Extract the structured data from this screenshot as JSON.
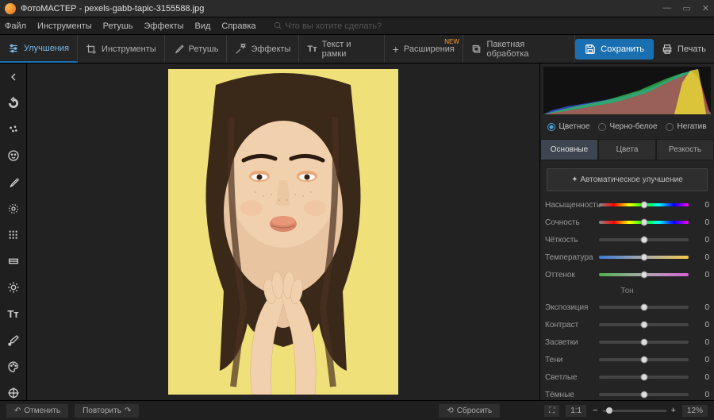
{
  "app": {
    "name": "ФотоМАСТЕР",
    "file": "pexels-gabb-tapic-3155588.jpg"
  },
  "menu": [
    "Файл",
    "Инструменты",
    "Ретушь",
    "Эффекты",
    "Вид",
    "Справка"
  ],
  "search_placeholder": "Что вы хотите сделать?",
  "tabs": [
    {
      "label": "Улучшения",
      "icon": "sliders"
    },
    {
      "label": "Инструменты",
      "icon": "crop"
    },
    {
      "label": "Ретушь",
      "icon": "brush"
    },
    {
      "label": "Эффекты",
      "icon": "wand"
    },
    {
      "label": "Текст и рамки",
      "icon": "text"
    },
    {
      "label": "Расширения",
      "icon": "plus",
      "badge": "NEW"
    },
    {
      "label": "Пакетная обработка",
      "icon": "stack"
    }
  ],
  "actions": {
    "save": "Сохранить",
    "print": "Печать"
  },
  "color_modes": [
    "Цветное",
    "Черно-белое",
    "Негатив"
  ],
  "subtabs": [
    "Основные",
    "Цвета",
    "Резкость"
  ],
  "auto_enhance": "Автоматическое улучшение",
  "sliders_a": [
    {
      "label": "Насыщенность",
      "grad": "grad-sat",
      "value": 0
    },
    {
      "label": "Сочность",
      "grad": "grad-sat",
      "value": 0
    },
    {
      "label": "Чёткость",
      "grad": "",
      "value": 0
    },
    {
      "label": "Температура",
      "grad": "grad-temp",
      "value": 0
    },
    {
      "label": "Оттенок",
      "grad": "grad-tint",
      "value": 0
    }
  ],
  "section_tone": "Тон",
  "sliders_b": [
    {
      "label": "Экспозиция",
      "value": 0
    },
    {
      "label": "Контраст",
      "value": 0
    },
    {
      "label": "Засветки",
      "value": 0
    },
    {
      "label": "Тени",
      "value": 0
    },
    {
      "label": "Светлые",
      "value": 0
    },
    {
      "label": "Тёмные",
      "value": 0
    }
  ],
  "bottom": {
    "undo": "Отменить",
    "redo": "Повторить",
    "reset": "Сбросить",
    "fit": "⛶",
    "ratio": "1:1",
    "zoom": "12%"
  }
}
